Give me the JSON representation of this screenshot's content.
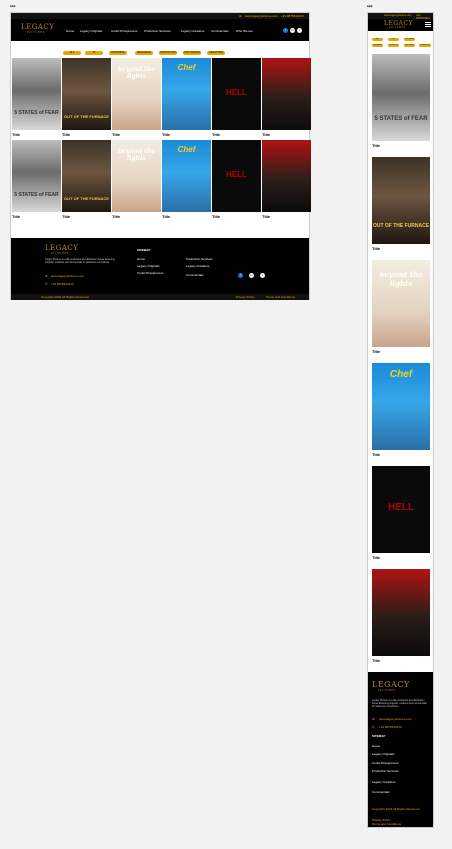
{
  "brand": {
    "logo_main": "LEGACY",
    "logo_sub": "PICTURES"
  },
  "contact": {
    "website": "www.legacypictures.com",
    "phone": "+91 9876543210"
  },
  "nav": {
    "items": [
      "Home",
      "Legacy Originals",
      "Contit Filmsprocess",
      "Production Services",
      "Legacy Creations",
      "Commercials",
      "Who We are"
    ]
  },
  "filters": [
    "ALL",
    "IN",
    "UPCOMING",
    "RELEASED",
    "PRODUCTION",
    "POST PRODUCTION",
    "CREATIVES"
  ],
  "movies": [
    {
      "title": "Title",
      "poster_text": "5 STATES of FEAR"
    },
    {
      "title": "Title",
      "poster_text": "OUT OF THE FURNACE"
    },
    {
      "title": "Title",
      "poster_text": "beyond the lights"
    },
    {
      "title": "Title",
      "poster_text": "Chef"
    },
    {
      "title": "Title",
      "poster_text": "HELL"
    },
    {
      "title": "Title",
      "poster_text": ""
    }
  ],
  "footer": {
    "description": "Legacy Pictures is a film production and distribution house delivering originals, creations and commercials for audiences everywhere.",
    "sitemap_label": "SITEMAP",
    "sitemap": [
      "Home",
      "Legacy Originals",
      "Contit Filmsprocess",
      "Production Services",
      "Legacy Creations",
      "Commercials"
    ],
    "copyright": "Copyright 2022 All Rights Reserved",
    "privacy": "Privacy Policy",
    "terms": "Terms and Conditions"
  },
  "social": [
    "f",
    "in",
    "t"
  ],
  "mobile_menu_icon": "hamburger-icon",
  "colors": {
    "accent": "#e6a400",
    "logo": "#b78a16",
    "nav_bg": "#000000",
    "facebook": "#1b74e4"
  }
}
